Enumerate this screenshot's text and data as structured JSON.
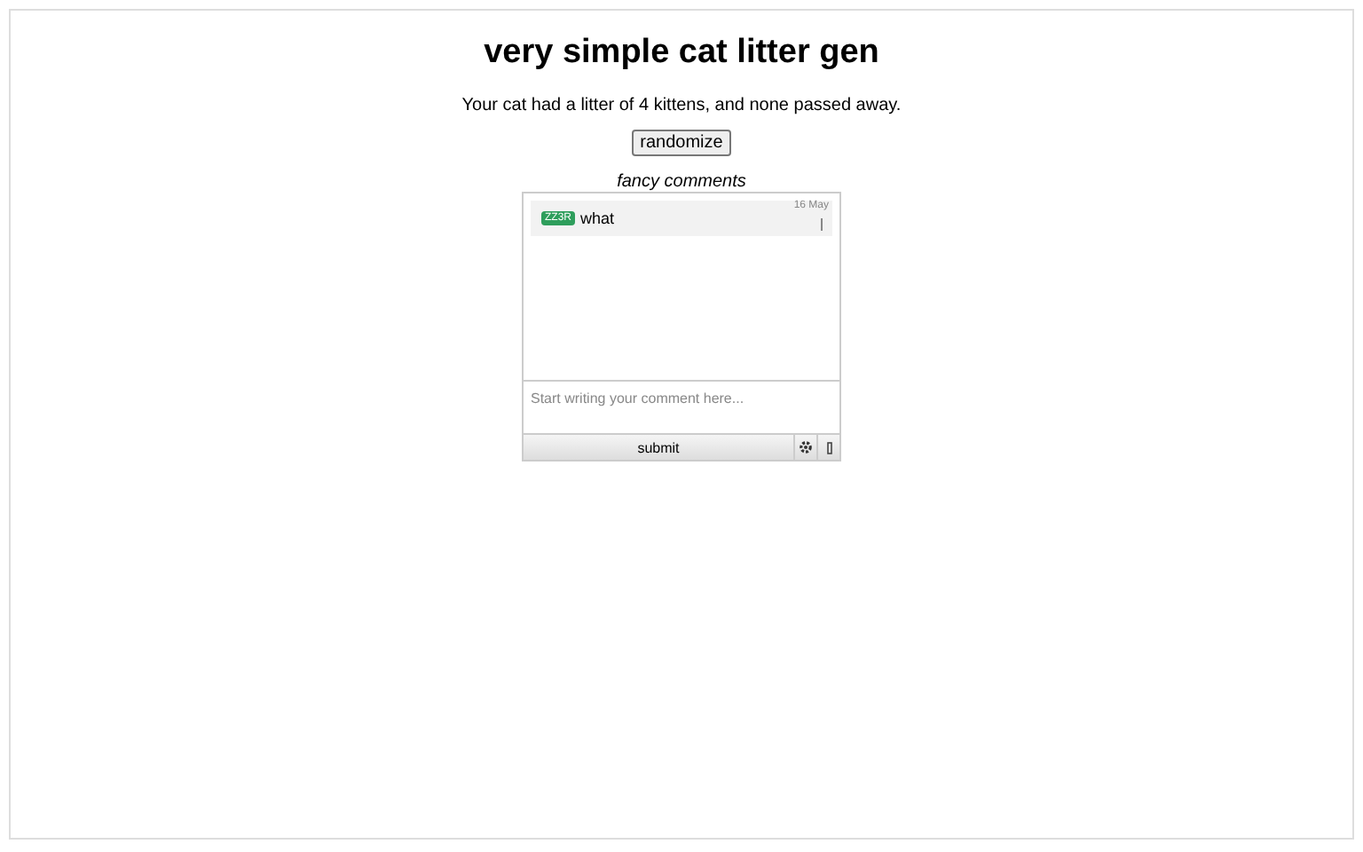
{
  "title": "very simple cat litter gen",
  "result": "Your cat had a litter of 4 kittens, and none passed away.",
  "randomize_button": "randomize",
  "comments": {
    "heading": "fancy comments",
    "items": [
      {
        "user": "ZZ3R",
        "text": "what",
        "date": "16 May"
      }
    ],
    "placeholder": "Start writing your comment here...",
    "submit": "submit"
  }
}
